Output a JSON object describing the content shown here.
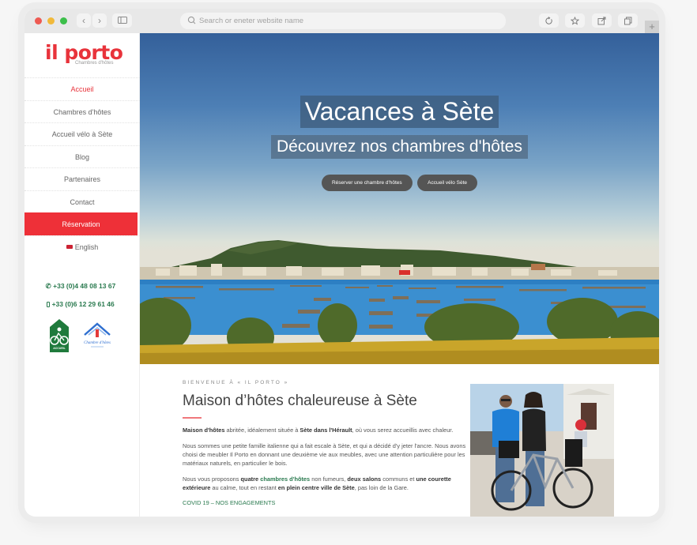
{
  "browser": {
    "url_placeholder": "Search or eneter website name",
    "new_tab_label": "+"
  },
  "sidebar": {
    "logo": {
      "main": "il porto",
      "sub": "Chambres d'hôtes"
    },
    "menu": [
      {
        "label": "Accueil",
        "active": true
      },
      {
        "label": "Chambres d'hôtes"
      },
      {
        "label": "Accueil vélo à Sète"
      },
      {
        "label": "Blog"
      },
      {
        "label": "Partenaires"
      },
      {
        "label": "Contact"
      },
      {
        "label": "Réservation",
        "highlight": true
      },
      {
        "label": "English",
        "icon": "uk-flag-icon"
      }
    ],
    "phone": "+33 (0)4 48 08 13 67",
    "mobile": "+33 (0)6 12 29 61 46",
    "badges": [
      {
        "label": "Accueil Vélo",
        "icon": "accueil-velo-badge"
      },
      {
        "label": "Chambre d'hôtes",
        "icon": "chambre-dhotes-badge"
      }
    ]
  },
  "hero": {
    "title": "Vacances à Sète",
    "subtitle": "Découvrez nos chambres d'hôtes",
    "buttons": [
      {
        "label": "Réserver une chambre d'hôtes"
      },
      {
        "label": "Accueil vélo Sète"
      }
    ]
  },
  "intro": {
    "eyebrow": "BIENVENUE À « IL PORTO »",
    "heading": "Maison d’hôtes chaleureuse à Sète",
    "p1": {
      "b1": "Maison d'hôtes",
      "t1": " abritée, idéalement située à ",
      "b2": "Sète dans l'Hérault",
      "t2": ", où vous serez accueillis avec chaleur."
    },
    "p2": "Nous sommes une petite famille italienne qui a fait escale à Sète, et qui a décidé d'y jeter l'ancre. Nous avons choisi de meubler Il Porto en donnant une deuxième vie aux meubles, avec une attention particulière pour les matériaux naturels, en particulier le bois.",
    "p3": {
      "t1": "Nous vous proposons ",
      "b1": "quatre",
      "link": "chambres d'hôtes",
      "t2": " non fumeurs, ",
      "b2": "deux salons",
      "t3": " communs et ",
      "b3": "une courette extérieure",
      "t4": " au calme, tout en restant ",
      "b4": "en plein centre ville de Sète",
      "t5": ", pas loin de la Gare."
    },
    "covid_link": "COVID 19 – NOS ENGAGEMENTS"
  },
  "colors": {
    "brand_red": "#e8333b",
    "accent_green": "#2a7a4f"
  }
}
